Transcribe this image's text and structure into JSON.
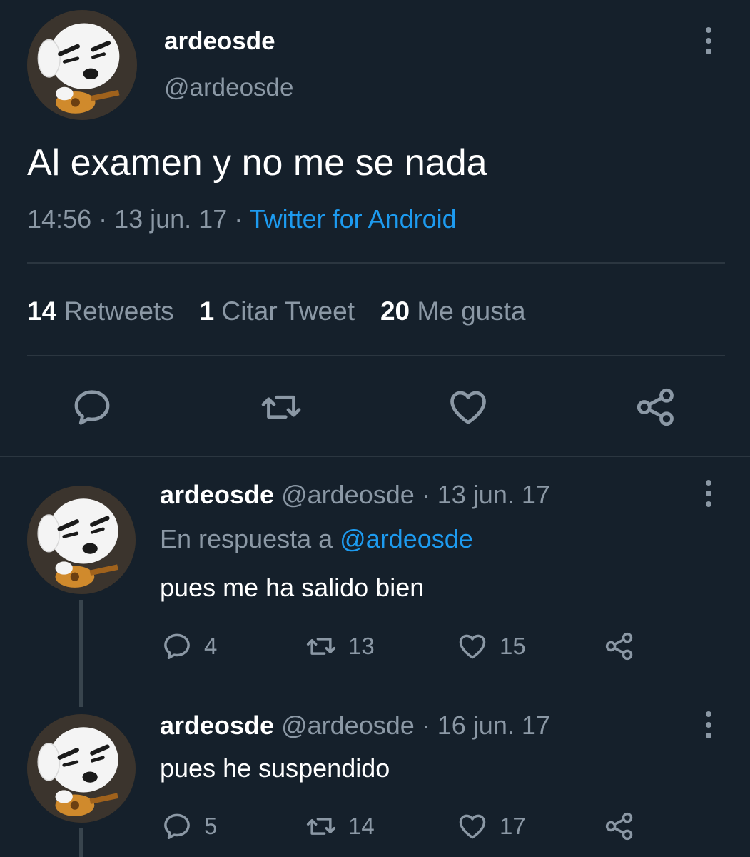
{
  "tweet": {
    "display_name": "ardeosde",
    "handle": "@ardeosde",
    "text": "Al examen y no me se nada",
    "time": "14:56",
    "date": "13 jun. 17",
    "source": "Twitter for Android",
    "separator": " · ",
    "stats": {
      "retweets_count": "14",
      "retweets_label": "Retweets",
      "quotes_count": "1",
      "quotes_label": "Citar Tweet",
      "likes_count": "20",
      "likes_label": "Me gusta"
    }
  },
  "replies": [
    {
      "display_name": "ardeosde",
      "handle": "@ardeosde",
      "date": "13 jun. 17",
      "reply_prefix": "En respuesta a",
      "reply_to": "@ardeosde",
      "text": "pues me ha salido bien",
      "replies": "4",
      "retweets": "13",
      "likes": "15"
    },
    {
      "display_name": "ardeosde",
      "handle": "@ardeosde",
      "date": "16 jun. 17",
      "text": "pues he suspendido",
      "replies": "5",
      "retweets": "14",
      "likes": "17"
    }
  ],
  "icons": {
    "reply": "speech-bubble-icon",
    "retweet": "retweet-arrows-icon",
    "like": "heart-icon",
    "share": "share-nodes-icon",
    "more": "vertical-ellipsis-icon"
  },
  "colors": {
    "background": "#15202b",
    "text": "#ffffff",
    "muted": "#8b98a5",
    "link": "#1d9bf0",
    "divider": "#2b3640"
  }
}
